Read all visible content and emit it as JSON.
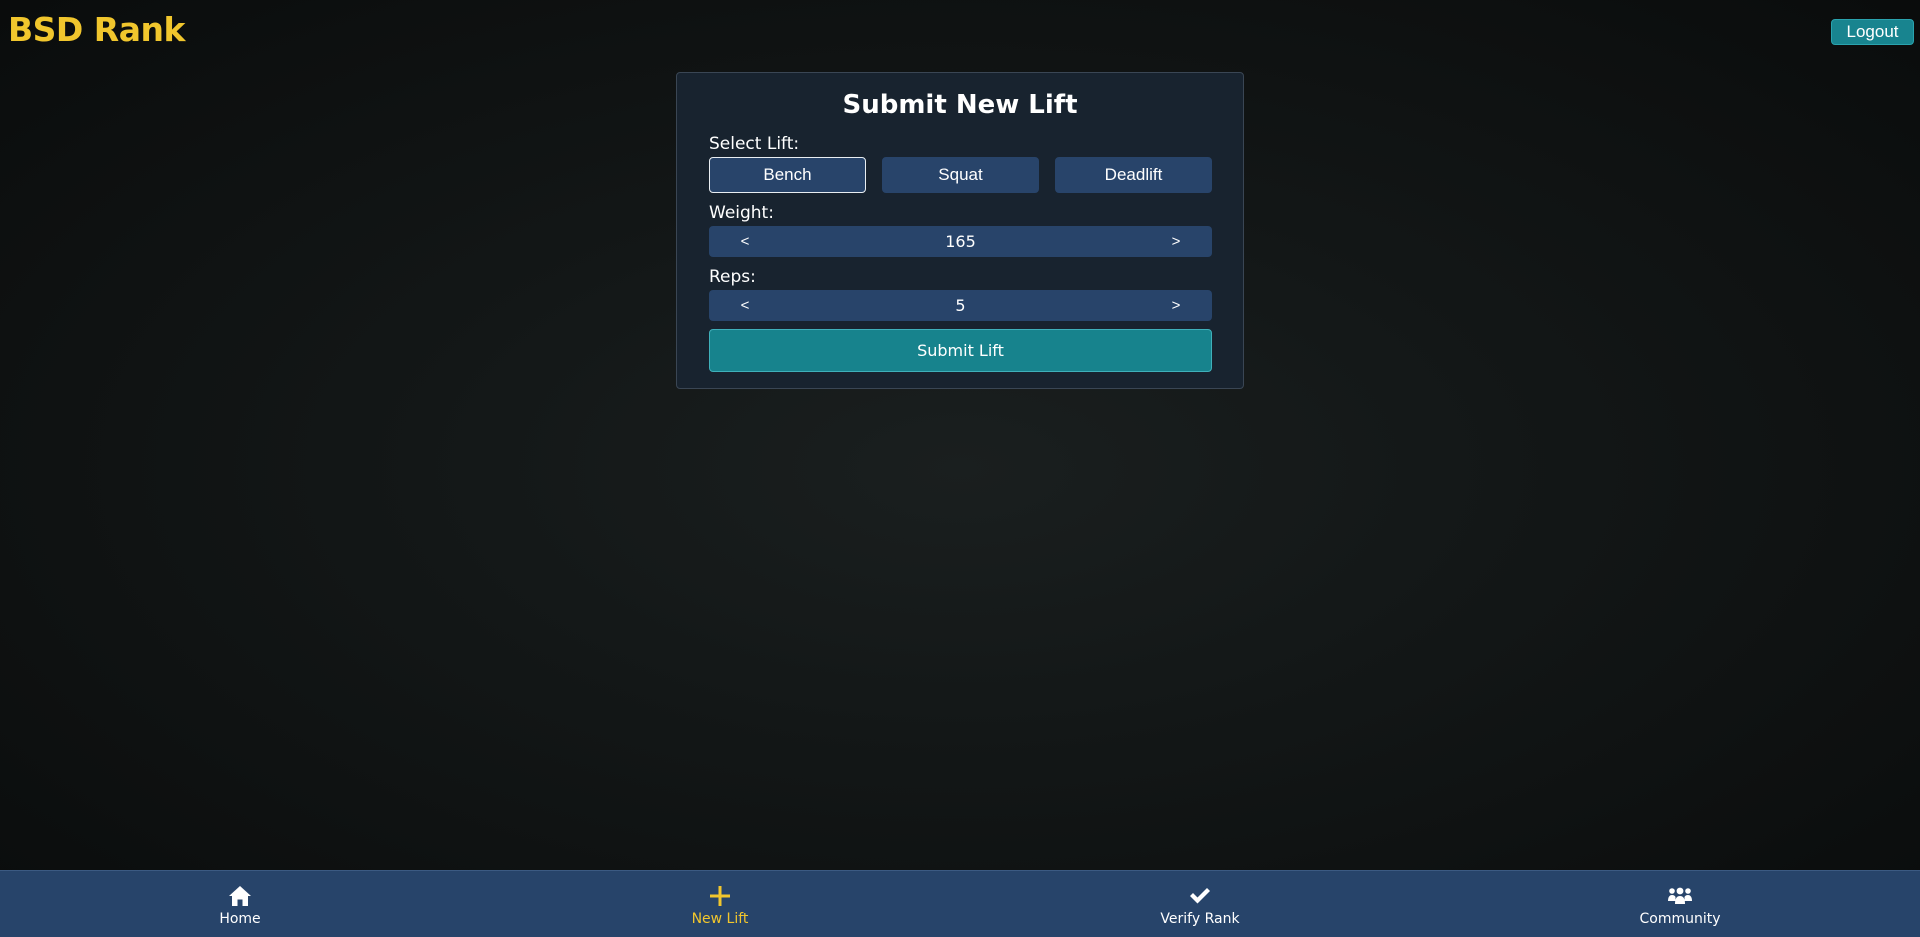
{
  "header": {
    "brand": "BSD Rank",
    "logout_label": "Logout"
  },
  "form": {
    "title": "Submit New Lift",
    "select_lift_label": "Select Lift:",
    "lifts": [
      {
        "label": "Bench",
        "selected": true
      },
      {
        "label": "Squat",
        "selected": false
      },
      {
        "label": "Deadlift",
        "selected": false
      }
    ],
    "weight": {
      "label": "Weight:",
      "value": "165",
      "decrement": "<",
      "increment": ">"
    },
    "reps": {
      "label": "Reps:",
      "value": "5",
      "decrement": "<",
      "increment": ">"
    },
    "submit_label": "Submit Lift"
  },
  "nav": {
    "items": [
      {
        "label": "Home",
        "icon": "home-icon",
        "active": false
      },
      {
        "label": "New Lift",
        "icon": "plus-icon",
        "active": true
      },
      {
        "label": "Verify Rank",
        "icon": "check-icon",
        "active": false
      },
      {
        "label": "Community",
        "icon": "users-icon",
        "active": false
      }
    ]
  },
  "colors": {
    "brand": "#f1c62d",
    "accent": "#17838d",
    "control": "#28446a",
    "card": "#18232f"
  }
}
